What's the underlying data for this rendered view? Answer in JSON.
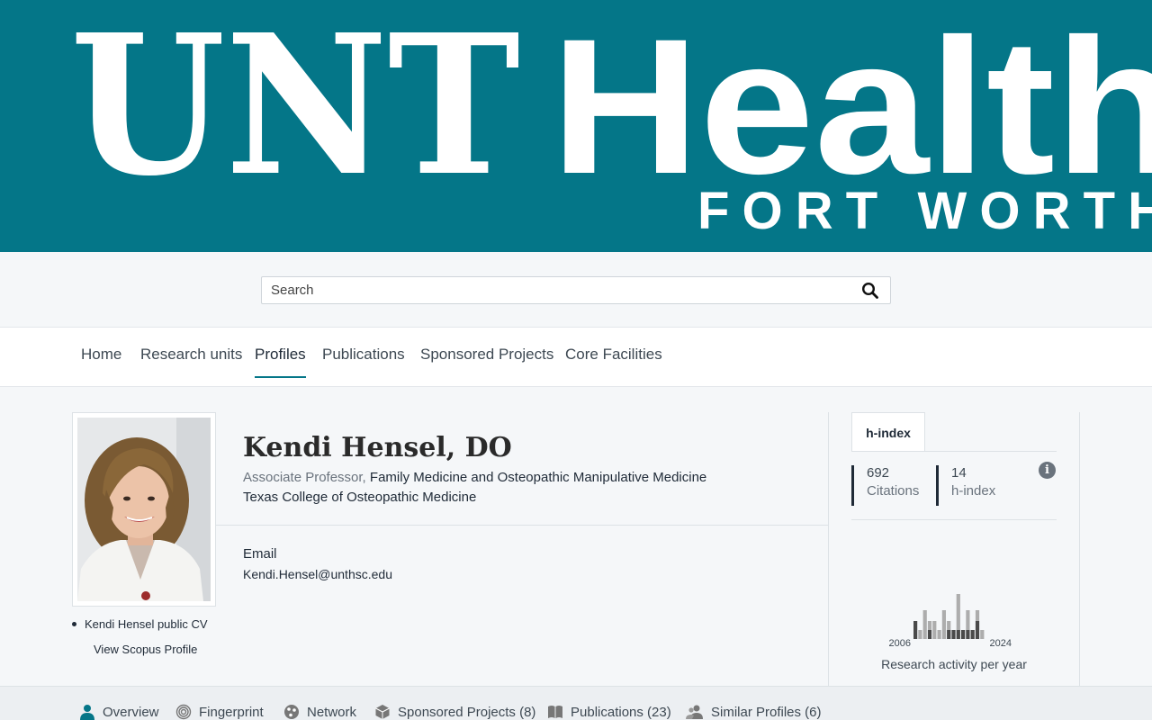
{
  "banner": {
    "line1a": "UNT",
    "line1b": "Health",
    "line2": "FORT WORTH",
    "color": "#047688"
  },
  "search": {
    "placeholder": "Search"
  },
  "nav": {
    "items": [
      {
        "label": "Home"
      },
      {
        "label": "Research units"
      },
      {
        "label": "Profiles"
      },
      {
        "label": "Publications"
      },
      {
        "label": "Sponsored Projects"
      },
      {
        "label": "Core Facilities"
      }
    ],
    "active": "Profiles"
  },
  "profile": {
    "name": "Kendi Hensel, DO",
    "title": "Associate Professor,",
    "department": "Family Medicine and Osteopathic Manipulative Medicine",
    "college": "Texas College of Osteopathic Medicine",
    "email_label": "Email",
    "email": "Kendi.Hensel@unthsc.edu",
    "cv_link": "Kendi Hensel public CV",
    "scopus_link": "View Scopus Profile"
  },
  "metrics": {
    "tab_label": "h-index",
    "citations": {
      "value": "692",
      "label": "Citations"
    },
    "hindex": {
      "value": "14",
      "label": "h-index"
    },
    "info_icon": "info-icon"
  },
  "activity": {
    "caption": "Research activity per year",
    "start_year": "2006",
    "end_year": "2024",
    "bars": [
      {
        "total": 1.0,
        "dark": 1.0
      },
      {
        "total": 0.5,
        "dark": 0.0
      },
      {
        "total": 1.6,
        "dark": 0.0
      },
      {
        "total": 1.0,
        "dark": 0.5
      },
      {
        "total": 1.0,
        "dark": 0.0
      },
      {
        "total": 0.5,
        "dark": 0.0
      },
      {
        "total": 1.6,
        "dark": 0.0
      },
      {
        "total": 1.0,
        "dark": 0.5
      },
      {
        "total": 0.5,
        "dark": 0.5
      },
      {
        "total": 2.5,
        "dark": 0.5
      },
      {
        "total": 0.5,
        "dark": 0.5
      },
      {
        "total": 1.6,
        "dark": 0.5
      },
      {
        "total": 0.5,
        "dark": 0.5
      },
      {
        "total": 1.6,
        "dark": 1.0
      },
      {
        "total": 0.5,
        "dark": 0.0
      }
    ],
    "colors": {
      "light": "#adadad",
      "dark": "#4a4a4a"
    }
  },
  "bottom_tabs": [
    {
      "label": "Overview",
      "icon": "person-icon"
    },
    {
      "label": "Fingerprint",
      "icon": "fingerprint-icon"
    },
    {
      "label": "Network",
      "icon": "network-icon"
    },
    {
      "label": "Sponsored Projects (8)",
      "icon": "cube-icon"
    },
    {
      "label": "Publications (23)",
      "icon": "book-icon"
    },
    {
      "label": "Similar Profiles (6)",
      "icon": "people-icon"
    }
  ]
}
